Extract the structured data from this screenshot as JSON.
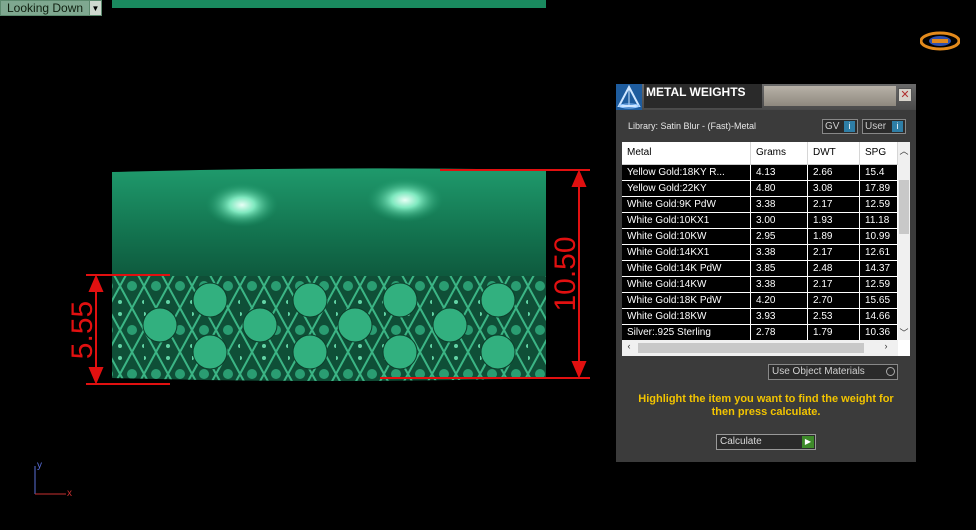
{
  "viewport": {
    "view_name": "Looking Down",
    "dimension_width": "5.55",
    "dimension_height": "10.50",
    "axis_y": "y",
    "axis_x": "x",
    "model_color": "#1f8a62",
    "dimension_color": "#e11010"
  },
  "panel": {
    "title": "METAL WEIGHTS",
    "library": "Library: Satin Blur - (Fast)-Metal",
    "toggle_gv": "GV",
    "toggle_user": "User",
    "columns": [
      "Metal",
      "Grams",
      "DWT",
      "SPG"
    ],
    "rows": [
      [
        "Yellow Gold:18KY R...",
        "4.13",
        "2.66",
        "15.4"
      ],
      [
        "Yellow Gold:22KY",
        "4.80",
        "3.08",
        "17.89"
      ],
      [
        "White Gold:9K PdW",
        "3.38",
        "2.17",
        "12.59"
      ],
      [
        "White Gold:10KX1",
        "3.00",
        "1.93",
        "11.18"
      ],
      [
        "White Gold:10KW",
        "2.95",
        "1.89",
        "10.99"
      ],
      [
        "White Gold:14KX1",
        "3.38",
        "2.17",
        "12.61"
      ],
      [
        "White Gold:14K PdW",
        "3.85",
        "2.48",
        "14.37"
      ],
      [
        "White Gold:14KW",
        "3.38",
        "2.17",
        "12.59"
      ],
      [
        "White Gold:18K PdW",
        "4.20",
        "2.70",
        "15.65"
      ],
      [
        "White Gold:18KW",
        "3.93",
        "2.53",
        "14.66"
      ],
      [
        "Silver:.925 Sterling",
        "2.78",
        "1.79",
        "10.36"
      ]
    ],
    "use_object_materials": "Use Object Materials",
    "hint": "Highlight the item you want to find the weight for then press calculate.",
    "calculate": "Calculate",
    "hint_color": "#f2c400"
  }
}
